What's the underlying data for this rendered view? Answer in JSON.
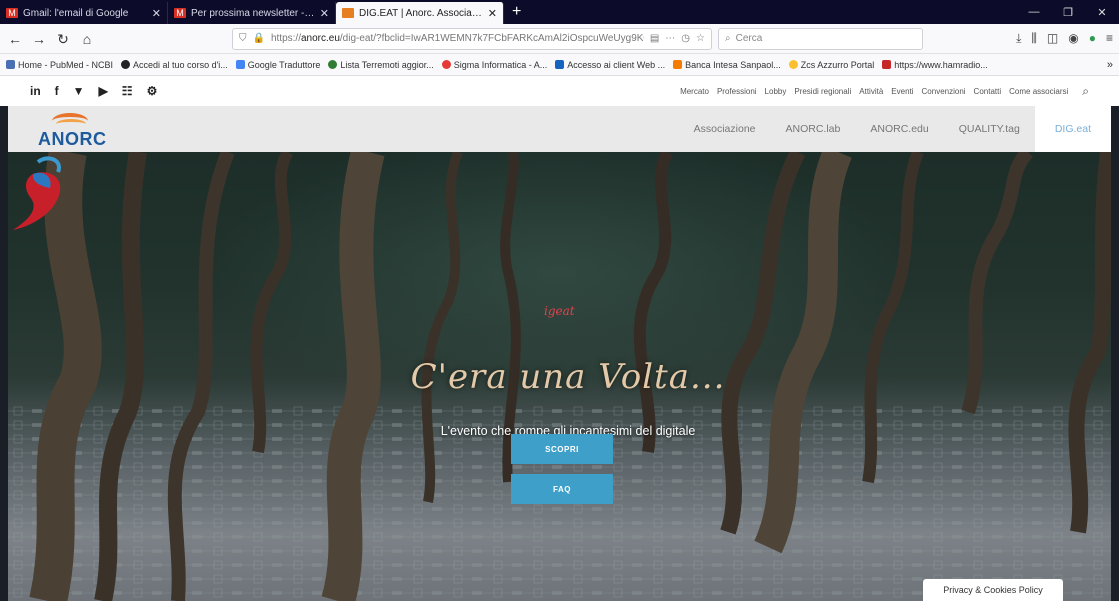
{
  "tabs": [
    {
      "title": "Gmail: l'email di Google",
      "icon": "gmail-icon",
      "active": false
    },
    {
      "title": "Per prossima newsletter - pro...",
      "icon": "gmail-icon",
      "active": false
    },
    {
      "title": "DIG.EAT | Anorc. Associazione...",
      "icon": "anorc-icon",
      "active": true
    }
  ],
  "browser": {
    "url_prefix": "https://",
    "url_domain": "anorc.eu",
    "url_rest": "/dig-eat/?fbclid=IwAR1WEMN7k7FCbFARKcAmAl2iOspcuWeUyg9K03...",
    "search_placeholder": "Cerca"
  },
  "bookmarks": [
    {
      "label": "Home - PubMed - NCBI",
      "color": "#4a6fb3"
    },
    {
      "label": "Accedi al tuo corso d'i...",
      "color": "#222222"
    },
    {
      "label": "Google Traduttore",
      "color": "#4285f4"
    },
    {
      "label": "Lista Terremoti aggior...",
      "color": "#2e7d32"
    },
    {
      "label": "Sigma Informatica - A...",
      "color": "#e53935"
    },
    {
      "label": "Accesso ai client Web ...",
      "color": "#1565c0"
    },
    {
      "label": "Banca Intesa Sanpaol...",
      "color": "#f57c00"
    },
    {
      "label": "Zcs Azzurro Portal",
      "color": "#fbc02d"
    },
    {
      "label": "https://www.hamradio...",
      "color": "#c62828"
    }
  ],
  "site": {
    "social": [
      "in",
      "f",
      "▼",
      "▶",
      "☷",
      "⚙"
    ],
    "toplinks": [
      "Mercato",
      "Professioni",
      "Lobby",
      "Presidi regionali",
      "Attività",
      "Eventi",
      "Convenzioni",
      "Contatti",
      "Come associarsi"
    ],
    "logo_text": "ANORC",
    "menu": [
      "Associazione",
      "ANORC.lab",
      "ANORC.edu",
      "QUALITY.tag",
      "DIG.eat"
    ],
    "active_menu": "DIG.eat"
  },
  "hero": {
    "mascot_text": "igeat",
    "title": "C'era una Volta...",
    "subtitle": "L'evento che rompe gli incantesimi del digitale",
    "btn_scopri": "SCOPRI",
    "btn_faq": "FAQ",
    "privacy": "Privacy & Cookies Policy"
  },
  "colors": {
    "accent": "#3ea0c9",
    "brand_blue": "#1d5b9c",
    "brand_orange": "#e8732b"
  }
}
